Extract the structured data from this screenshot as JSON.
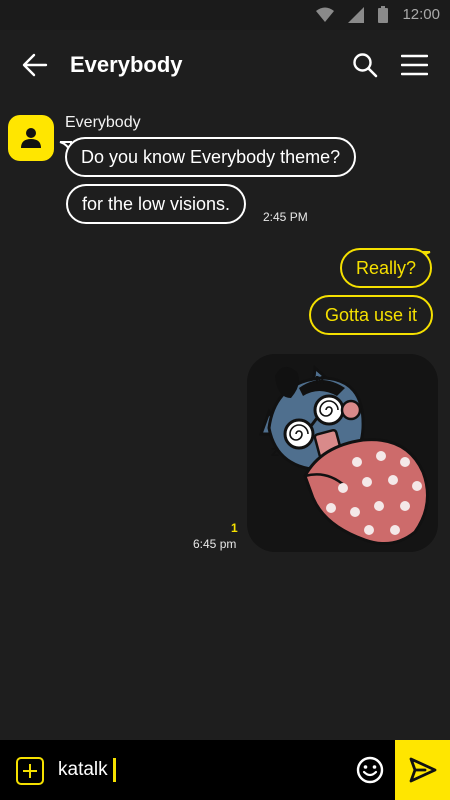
{
  "status_bar": {
    "time": "12:00",
    "icons": [
      "wifi-icon",
      "signal-icon",
      "battery-icon"
    ]
  },
  "header": {
    "title": "Everybody",
    "icons": {
      "back": "arrow-left-icon",
      "search": "search-icon",
      "menu": "hamburger-menu-icon"
    }
  },
  "chat": {
    "incoming": {
      "sender": "Everybody",
      "avatar_icon": "person-icon",
      "messages": [
        "Do you know Everybody theme?",
        "for the low visions."
      ],
      "time": "2:45 PM"
    },
    "outgoing": {
      "messages": [
        "Really?",
        "Gotta use it"
      ],
      "sticker_icon": "sticker-character-reading-icon",
      "unread_count": "1",
      "time": "6:45 pm"
    }
  },
  "input_bar": {
    "value": "katalk",
    "icons": {
      "plus": "plus-icon",
      "emoji": "emoji-smile-icon",
      "send": "send-icon"
    }
  },
  "colors": {
    "accent": "#ffe600",
    "background": "#1e1e1e",
    "bubble_border": "#ffffff"
  }
}
